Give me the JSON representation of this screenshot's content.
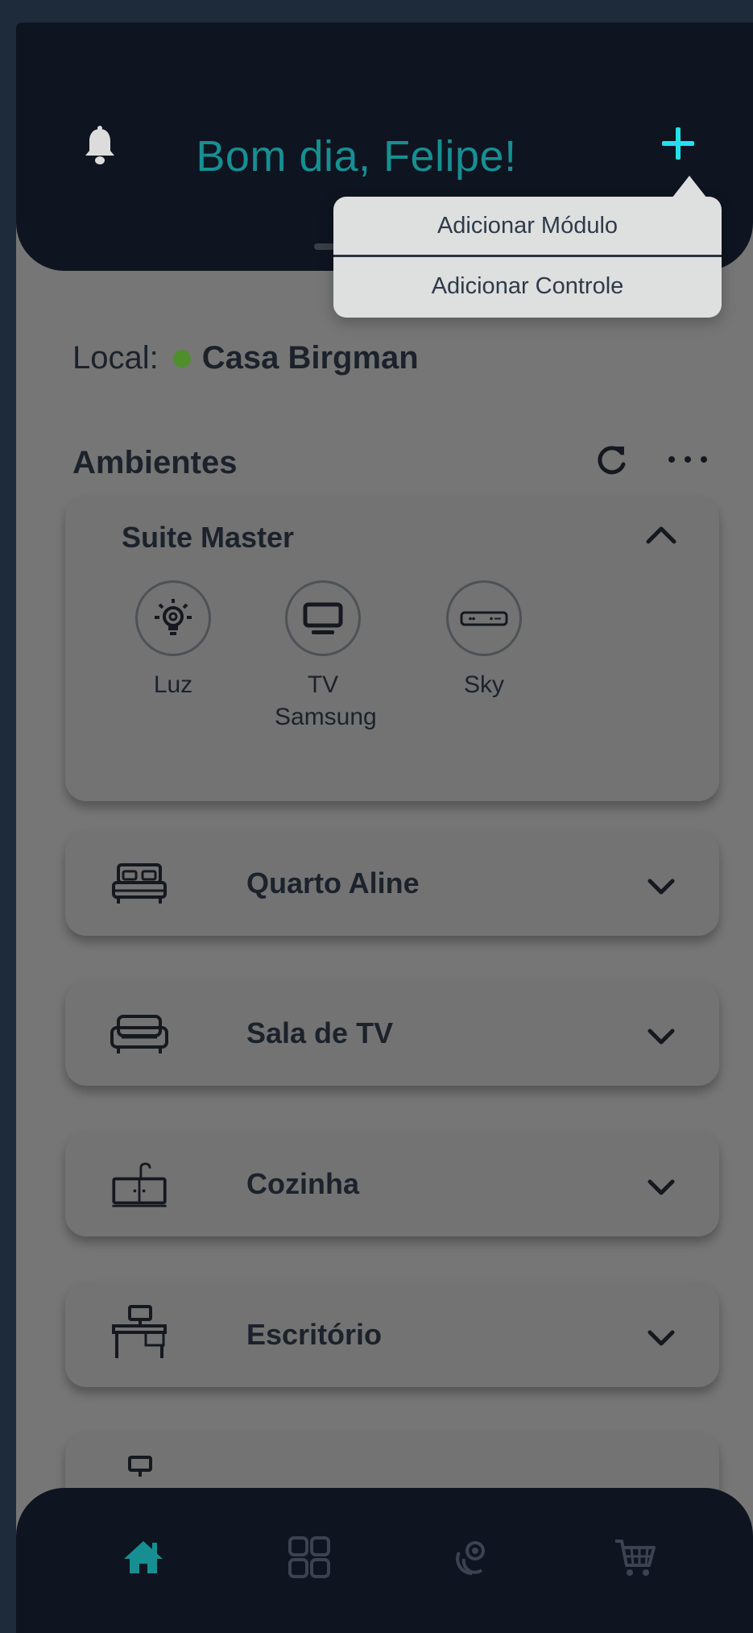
{
  "header": {
    "greeting": "Bom dia, Felipe!",
    "icons": {
      "left": "bell-icon",
      "right": "plus-icon"
    }
  },
  "popover": {
    "items": [
      "Adicionar Módulo",
      "Adicionar Controle"
    ]
  },
  "local": {
    "label": "Local:",
    "place": "Casa Birgman",
    "status_color": "#4e8f2c"
  },
  "ambientes": {
    "title": "Ambientes",
    "icons": [
      "refresh-icon",
      "more-icon"
    ]
  },
  "suite": {
    "title": "Suite Master",
    "devices": [
      {
        "label": "Luz",
        "icon": "lightbulb-icon"
      },
      {
        "label": "TV Samsung",
        "icon": "tv-icon"
      },
      {
        "label": "Sky",
        "icon": "set-top-box-icon"
      }
    ]
  },
  "rooms": [
    {
      "label": "Quarto Aline",
      "icon": "bed-icon"
    },
    {
      "label": "Sala de TV",
      "icon": "sofa-icon"
    },
    {
      "label": "Cozinha",
      "icon": "sink-icon"
    },
    {
      "label": "Escritório",
      "icon": "desk-icon"
    }
  ],
  "nav": {
    "items": [
      "home-icon",
      "grid-icon",
      "scene-icon",
      "cart-icon"
    ],
    "active_color": "#178f92"
  },
  "colors": {
    "accent": "#22e1ec",
    "greeting": "#178f92",
    "header_bg": "#0e1520"
  }
}
